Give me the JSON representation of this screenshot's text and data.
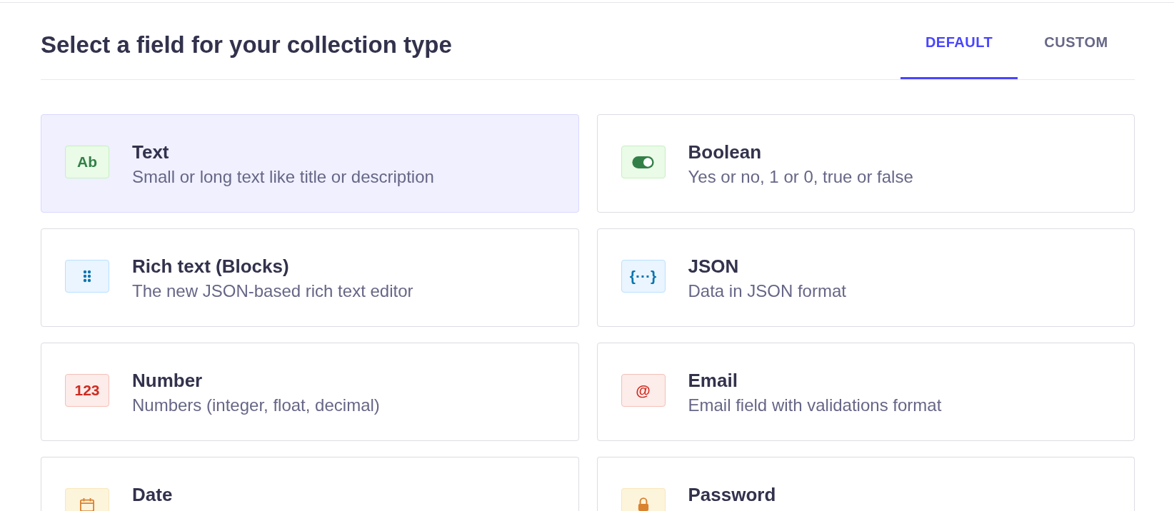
{
  "header": {
    "title": "Select a field for your collection type"
  },
  "tabs": [
    {
      "label": "DEFAULT",
      "selected": true
    },
    {
      "label": "CUSTOM",
      "selected": false
    }
  ],
  "fields": [
    {
      "kind": "text",
      "glyph": "Ab",
      "title": "Text",
      "description": "Small or long text like title or description",
      "selected": true
    },
    {
      "kind": "boolean",
      "title": "Boolean",
      "description": "Yes or no, 1 or 0, true or false",
      "selected": false
    },
    {
      "kind": "blocks",
      "title": "Rich text (Blocks)",
      "description": "The new JSON-based rich text editor",
      "selected": false
    },
    {
      "kind": "json",
      "glyph": "{···}",
      "title": "JSON",
      "description": "Data in JSON format",
      "selected": false
    },
    {
      "kind": "number",
      "glyph": "123",
      "title": "Number",
      "description": "Numbers (integer, float, decimal)",
      "selected": false
    },
    {
      "kind": "email",
      "glyph": "@",
      "title": "Email",
      "description": "Email field with validations format",
      "selected": false
    },
    {
      "kind": "date",
      "title": "Date",
      "selected": false
    },
    {
      "kind": "password",
      "title": "Password",
      "selected": false
    }
  ]
}
